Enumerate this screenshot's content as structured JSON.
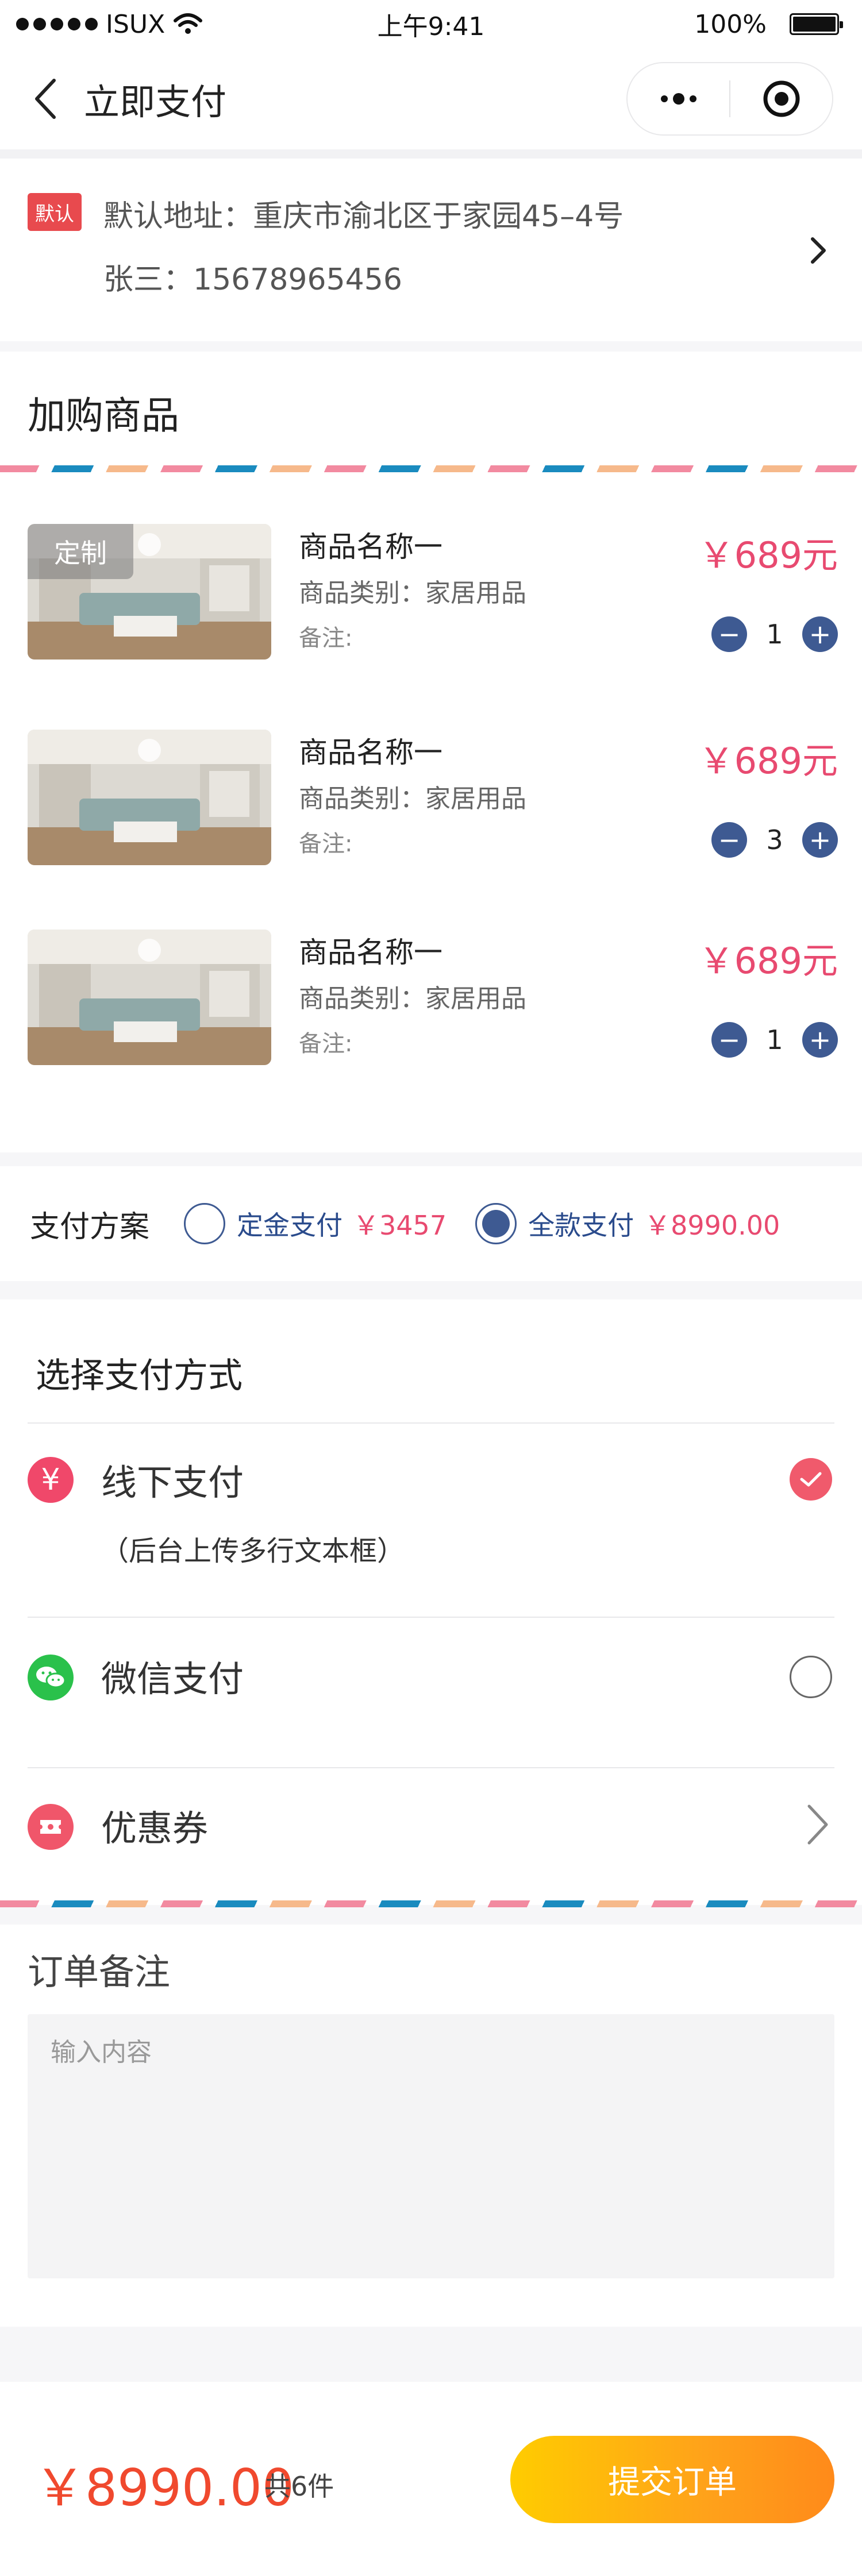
{
  "status_bar": {
    "carrier": "ISUX",
    "time": "上午9:41",
    "battery": "100%"
  },
  "nav": {
    "title": "立即支付",
    "more_icon": "more-dots-icon",
    "close_icon": "target-icon"
  },
  "address": {
    "badge": "默认",
    "line": "默认地址：重庆市渝北区于家园45–4号",
    "contact": "张三：15678965456"
  },
  "products_section": {
    "title": "加购商品",
    "items": [
      {
        "tag": "定制",
        "name": "商品名称一",
        "category": "商品类别：家居用品",
        "note": "备注:",
        "price": "￥689元",
        "qty": "1"
      },
      {
        "tag": "",
        "name": "商品名称一",
        "category": "商品类别：家居用品",
        "note": "备注:",
        "price": "￥689元",
        "qty": "3"
      },
      {
        "tag": "",
        "name": "商品名称一",
        "category": "商品类别：家居用品",
        "note": "备注:",
        "price": "￥689元",
        "qty": "1"
      }
    ]
  },
  "payment_plan": {
    "label": "支付方案",
    "options": [
      {
        "label": "定金支付",
        "price": "￥3457",
        "selected": false
      },
      {
        "label": "全款支付",
        "price": "￥8990.00",
        "selected": true
      }
    ]
  },
  "payment_methods": {
    "title": "选择支付方式",
    "offline": {
      "label": "线下支付",
      "note": "（后台上传多行文本框）",
      "selected": true
    },
    "wechat": {
      "label": "微信支付",
      "selected": false
    },
    "coupon": {
      "label": "优惠券"
    }
  },
  "order_note": {
    "title": "订单备注",
    "placeholder": "输入内容"
  },
  "footer": {
    "total": "￥8990.00",
    "count": "共6件",
    "submit_label": "提交订单"
  },
  "colors": {
    "accent_red": "#f0492e",
    "price_pink": "#e84a70",
    "navy": "#3e5a92",
    "wechat_green": "#2ac14b",
    "submit_yellow": "#ffcc00"
  }
}
